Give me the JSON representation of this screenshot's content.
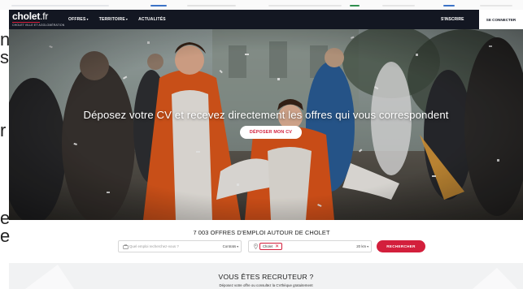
{
  "background_page": {
    "edge_chars": [
      "n",
      "s",
      "",
      "r",
      "",
      "",
      "e",
      "e"
    ]
  },
  "navbar": {
    "logo_name": "cholet",
    "logo_tld": ".fr",
    "logo_tagline": "CHOLET VILLE ET AGGLOMÉRATION",
    "menu": [
      {
        "label": "OFFRES",
        "has_caret": true
      },
      {
        "label": "TERRITOIRE",
        "has_caret": true
      },
      {
        "label": "ACTUALITÉS",
        "has_caret": false
      }
    ],
    "caret_glyph": "▾",
    "signup_label": "S'INSCRIRE",
    "login_label": "SE CONNECTER"
  },
  "hero": {
    "title": "Déposez votre CV et recevez directement les offres qui vous correspondent",
    "cta_label": "DÉPOSER MON CV"
  },
  "search": {
    "results_title": "7 003 OFFRES D'EMPLOI AUTOUR DE CHOLET",
    "job_placeholder": "Quel emploi recherchez-vous ?",
    "contract_label": "Contrats",
    "location_value": "Cholet",
    "location_remove": "✕",
    "radius_label": "20 km",
    "button_label": "RECHERCHER",
    "icons": {
      "job": "briefcase-icon",
      "location": "map-pin-icon"
    }
  },
  "recruiter": {
    "title": "VOUS ÊTES RECRUTEUR ?",
    "subtitle": "Déposez votre offre ou consultez la CVthèque gratuitement"
  },
  "colors": {
    "navbar_bg": "#131722",
    "accent_red": "#d31f3c",
    "recruiter_bg": "#f1f2f3"
  }
}
